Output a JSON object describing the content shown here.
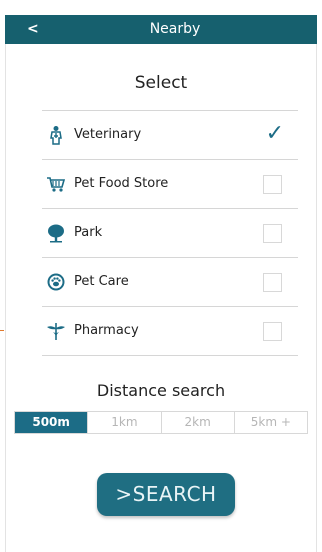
{
  "header": {
    "back_label": "<",
    "title": "Nearby"
  },
  "select_title": "Select",
  "categories": [
    {
      "label": "Veterinary",
      "icon": "vet-icon",
      "checked": true
    },
    {
      "label": "Pet Food Store",
      "icon": "cart-icon",
      "checked": false
    },
    {
      "label": "Park",
      "icon": "tree-icon",
      "checked": false
    },
    {
      "label": "Pet Care",
      "icon": "paw-icon",
      "checked": false
    },
    {
      "label": "Pharmacy",
      "icon": "caduceus-icon",
      "checked": false
    }
  ],
  "check_glyph": "✓",
  "distance": {
    "title": "Distance search",
    "options": [
      "500m",
      "1km",
      "2km",
      "5km +"
    ],
    "selected": "500m"
  },
  "search_label": ">SEARCH",
  "colors": {
    "accent": "#16606e",
    "check": "#1c6c86",
    "button": "#1f6e82"
  }
}
